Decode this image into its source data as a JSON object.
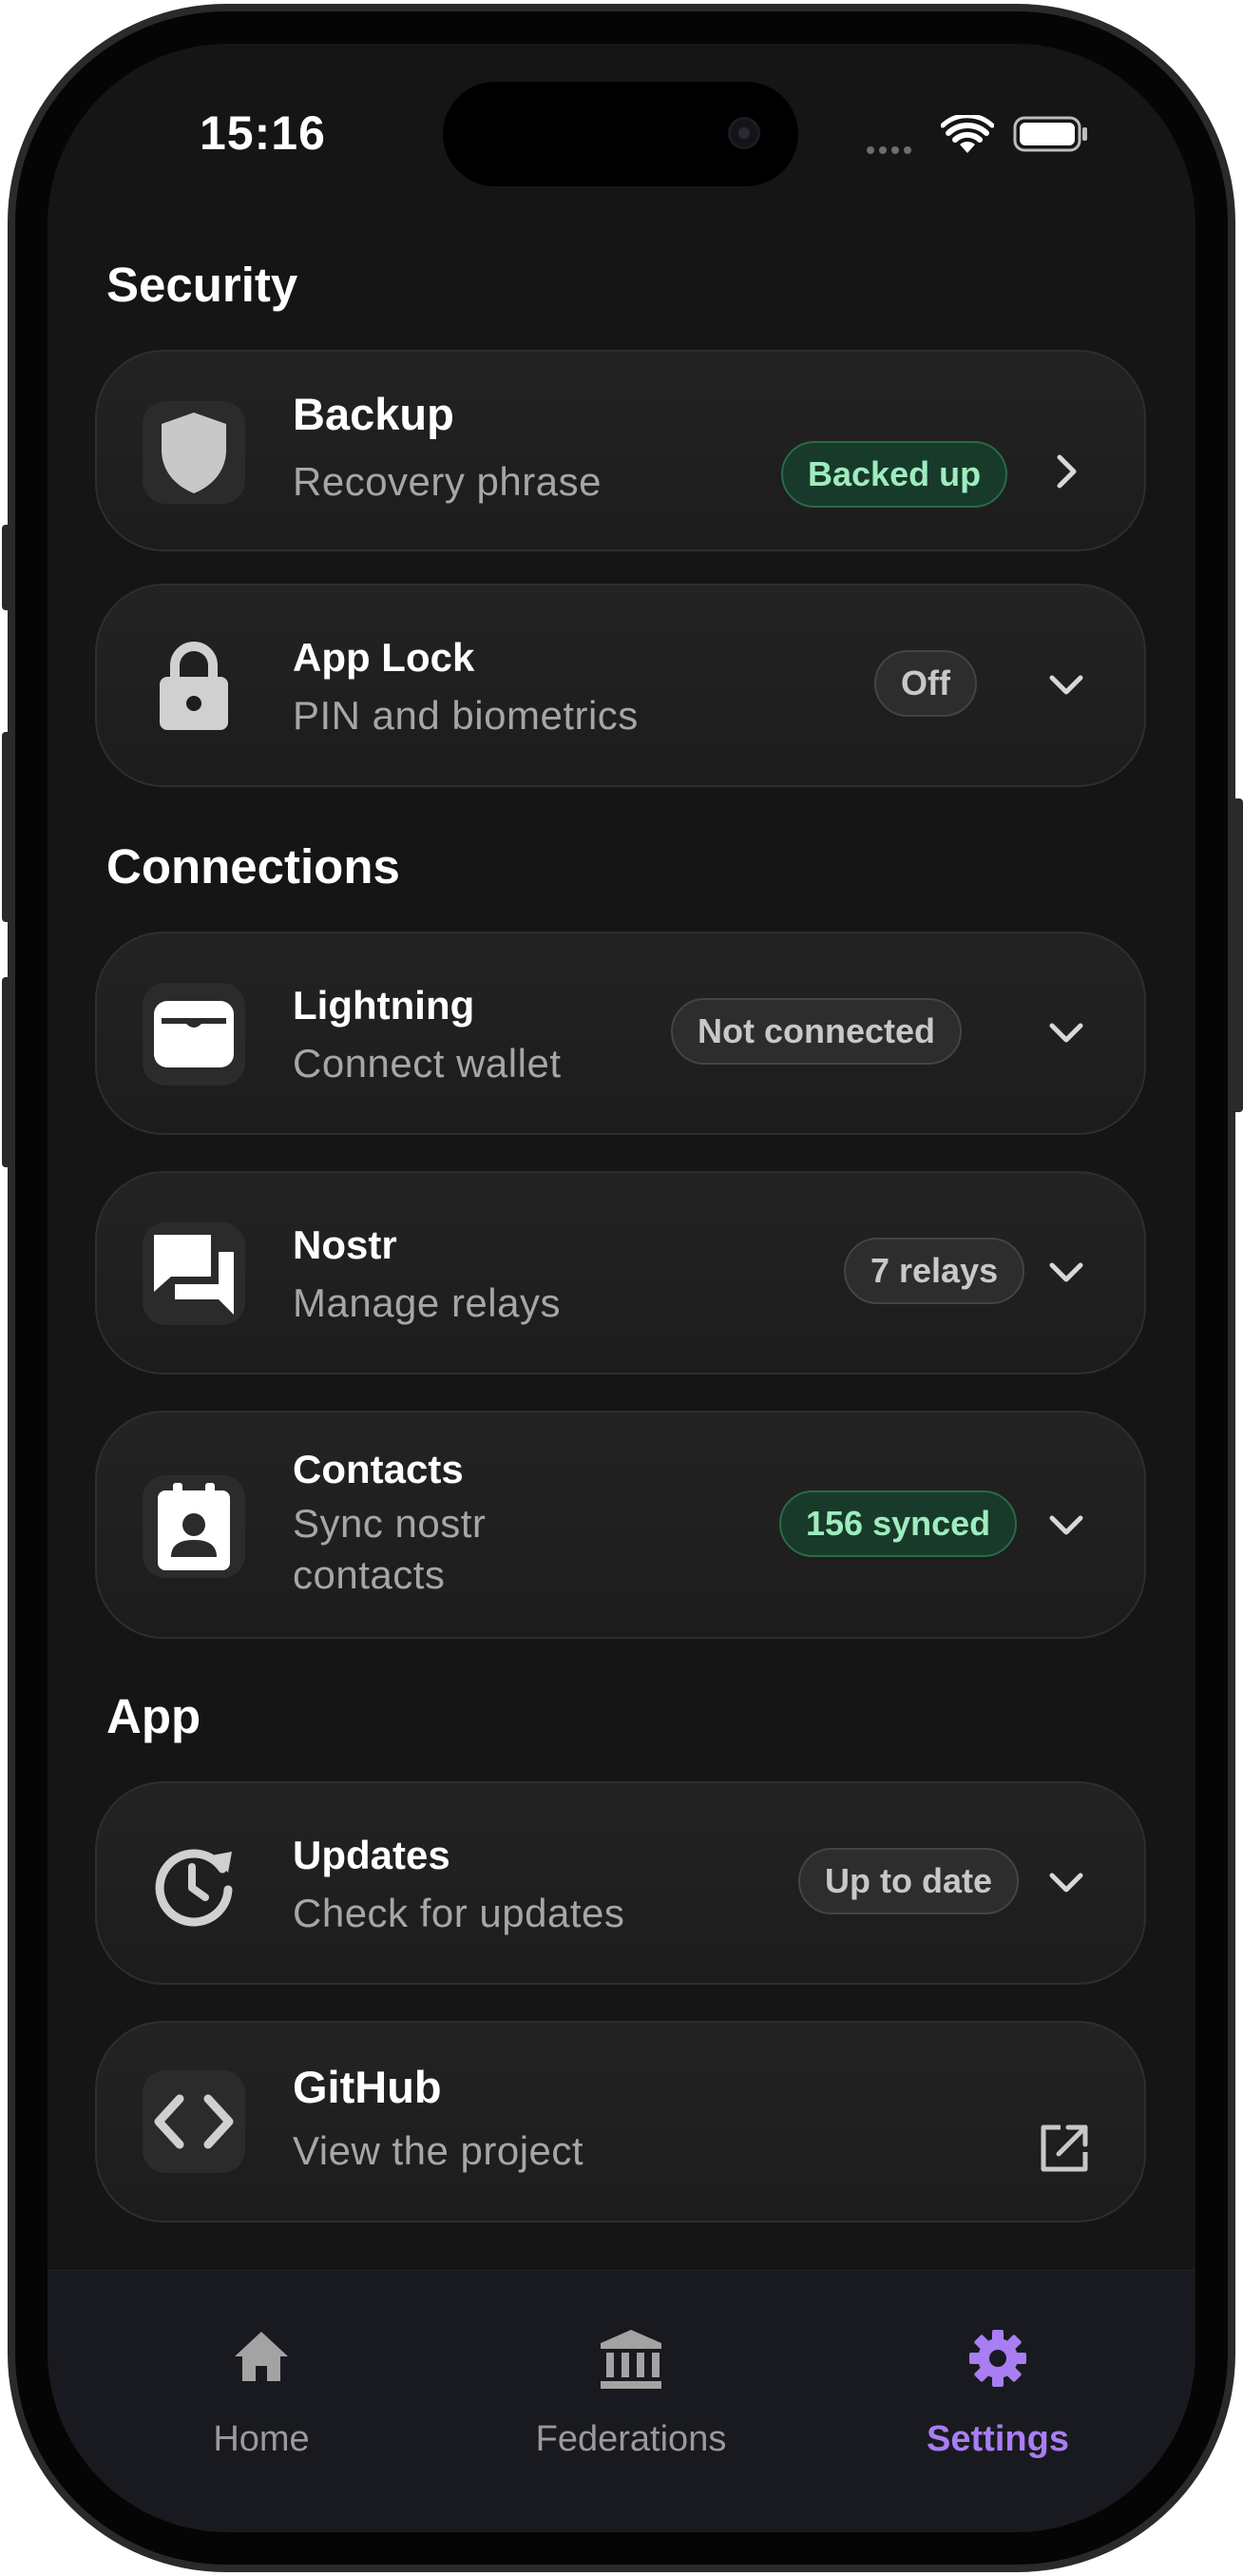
{
  "status_bar": {
    "time": "15:16"
  },
  "sections": {
    "security": "Security",
    "connections": "Connections",
    "app": "App"
  },
  "items": {
    "backup": {
      "icon": "shield-icon",
      "title": "Backup",
      "subtitle": "Recovery phrase",
      "badge": "Backed up",
      "badge_style": "success",
      "action": "chevron-right-icon"
    },
    "app_lock": {
      "icon": "lock-icon",
      "title": "App Lock",
      "subtitle": "PIN and biometrics",
      "badge": "Off",
      "badge_style": "neutral",
      "action": "chevron-down-icon"
    },
    "lightning": {
      "icon": "wallet-icon",
      "title": "Lightning",
      "subtitle": "Connect wallet",
      "badge": "Not connected",
      "badge_style": "neutral",
      "action": "chevron-down-icon"
    },
    "nostr": {
      "icon": "chat-bubbles-icon",
      "title": "Nostr",
      "subtitle": "Manage relays",
      "badge": "7 relays",
      "badge_style": "neutral",
      "action": "chevron-down-icon"
    },
    "contacts": {
      "icon": "contact-card-icon",
      "title": "Contacts",
      "subtitle_line1": "Sync nostr",
      "subtitle_line2": "contacts",
      "badge": "156 synced",
      "badge_style": "success",
      "action": "chevron-down-icon"
    },
    "updates": {
      "icon": "update-history-icon",
      "title": "Updates",
      "subtitle": "Check for updates",
      "badge": "Up to date",
      "badge_style": "neutral",
      "action": "chevron-down-icon"
    },
    "github": {
      "icon": "code-icon",
      "title": "GitHub",
      "subtitle": "View the project",
      "action": "open-external-icon"
    }
  },
  "bottom_nav": {
    "home": "Home",
    "federations": "Federations",
    "settings": "Settings",
    "active": "settings"
  },
  "colors": {
    "accent": "#a87ef3",
    "success_bg": "#183a2a",
    "success_text": "#9eecbf",
    "background": "#151515"
  }
}
